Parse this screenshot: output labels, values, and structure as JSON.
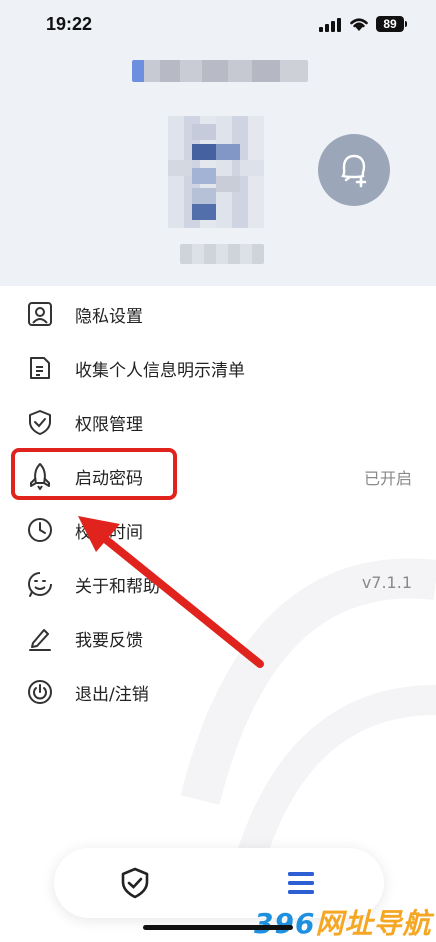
{
  "status_bar": {
    "time": "19:22",
    "battery": "89"
  },
  "header": {
    "add_contact_icon": "user-add-icon"
  },
  "menu": {
    "items": [
      {
        "label": "隐私设置",
        "value": "",
        "icon": "user-card-icon"
      },
      {
        "label": "收集个人信息明示清单",
        "value": "",
        "icon": "document-icon"
      },
      {
        "label": "权限管理",
        "value": "",
        "icon": "shield-check-icon"
      },
      {
        "label": "启动密码",
        "value": "已开启",
        "icon": "rocket-icon"
      },
      {
        "label": "校准时间",
        "value": "",
        "icon": "clock-icon"
      },
      {
        "label": "关于和帮助",
        "value": "v7.1.1",
        "icon": "smile-icon"
      },
      {
        "label": "我要反馈",
        "value": "",
        "icon": "pen-icon"
      },
      {
        "label": "退出/注销",
        "value": "",
        "icon": "power-icon"
      }
    ]
  },
  "bottom_nav": {
    "tabs": [
      {
        "icon": "shield-check-icon"
      },
      {
        "icon": "menu-icon"
      }
    ]
  },
  "watermark": {
    "text_num": "396",
    "text_rest": "网址导航"
  },
  "colors": {
    "header_bg": "#eef1f6",
    "highlight": "#e0231d",
    "accent_blue": "#2c5fd4",
    "muted": "#8a8a8a"
  }
}
